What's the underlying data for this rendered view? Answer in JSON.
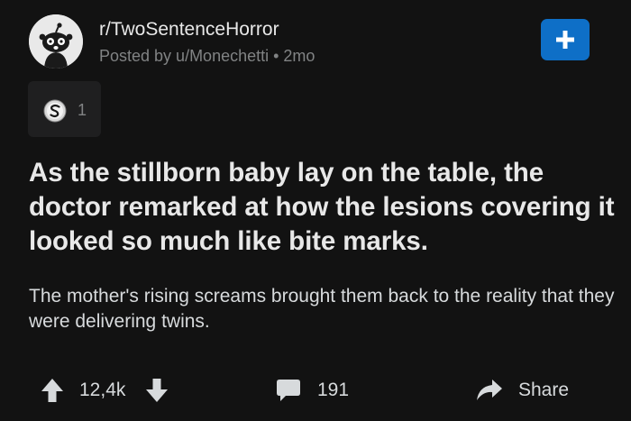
{
  "post": {
    "subreddit": "r/TwoSentenceHorror",
    "posted_by": "Posted by u/Monechetti • 2mo",
    "award_count": "1",
    "title": "As the stillborn baby lay on the table, the doctor remarked at how the lesions covering it looked so much like bite marks.",
    "body": "The mother's rising screams brought them back to the reality that they were delivering twins."
  },
  "actions": {
    "score": "12,4k",
    "comments": "191",
    "share_label": "Share"
  },
  "icons": {
    "avatar": "snoo-icon",
    "join": "plus-icon",
    "award": "silver-award-icon",
    "upvote": "arrow-up-icon",
    "downvote": "arrow-down-icon",
    "comments": "comment-bubble-icon",
    "share": "share-arrow-icon"
  },
  "colors": {
    "background": "#121212",
    "accent": "#0e6fc7",
    "text_primary": "#e8e8e8",
    "text_secondary": "#818384"
  }
}
